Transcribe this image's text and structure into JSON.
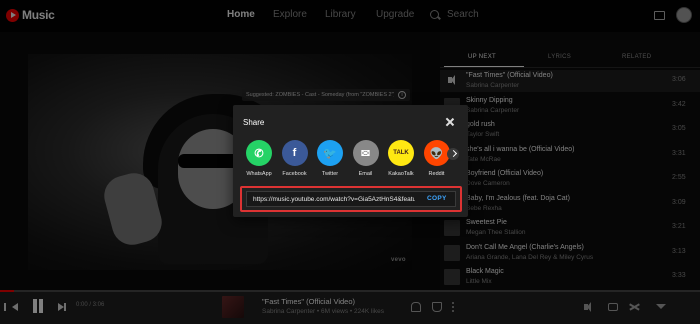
{
  "app": {
    "logo_text": "Music"
  },
  "nav": {
    "home": "Home",
    "explore": "Explore",
    "library": "Library",
    "upgrade": "Upgrade",
    "search": "Search"
  },
  "video": {
    "suggestion": "Suggested: ZOMBIES - Cast - Someday (from \"ZOMBIES 2\")",
    "watermark": "vevo"
  },
  "panel": {
    "tabs": [
      "UP NEXT",
      "LYRICS",
      "RELATED"
    ],
    "queue": [
      {
        "title": "\"Fast Times\" (Official Video)",
        "artist": "Sabrina Carpenter",
        "duration": "3:06",
        "playing": true
      },
      {
        "title": "Skinny Dipping",
        "artist": "Sabrina Carpenter",
        "duration": "3:42",
        "playing": false
      },
      {
        "title": "gold rush",
        "artist": "Taylor Swift",
        "duration": "3:05",
        "playing": false
      },
      {
        "title": "she's all i wanna be (Official Video)",
        "artist": "Tate McRae",
        "duration": "3:31",
        "playing": false
      },
      {
        "title": "Boyfriend (Official Video)",
        "artist": "Dove Cameron",
        "duration": "2:55",
        "playing": false
      },
      {
        "title": "Baby, I'm Jealous (feat. Doja Cat)",
        "artist": "Bebe Rexha",
        "duration": "3:09",
        "playing": false
      },
      {
        "title": "Sweetest Pie",
        "artist": "Megan Thee Stallion",
        "duration": "3:21",
        "playing": false
      },
      {
        "title": "Don't Call Me Angel (Charlie's Angels)",
        "artist": "Ariana Grande, Lana Del Rey & Miley Cyrus",
        "duration": "3:13",
        "playing": false
      },
      {
        "title": "Black Magic",
        "artist": "Little Mix",
        "duration": "3:33",
        "playing": false
      }
    ]
  },
  "player": {
    "time": "0:00 / 3:06",
    "progress": 0.02,
    "now_playing_title": "\"Fast Times\" (Official Video)",
    "now_playing_sub": "Sabrina Carpenter • 6M views • 224K likes"
  },
  "share": {
    "title": "Share",
    "targets": [
      {
        "label": "WhatsApp",
        "glyph": "✆",
        "color": "#25d366"
      },
      {
        "label": "Facebook",
        "glyph": "f",
        "color": "#3b5998"
      },
      {
        "label": "Twitter",
        "glyph": "🐦",
        "color": "#1da1f2"
      },
      {
        "label": "Email",
        "glyph": "✉",
        "color": "#888888"
      },
      {
        "label": "KakaoTalk",
        "glyph": "TALK",
        "color": "#ffe812"
      },
      {
        "label": "Reddit",
        "glyph": "👽",
        "color": "#ff4500"
      }
    ],
    "url": "https://music.youtube.com/watch?v=Gia5AztHnS4&featu",
    "copy_label": "COPY"
  }
}
